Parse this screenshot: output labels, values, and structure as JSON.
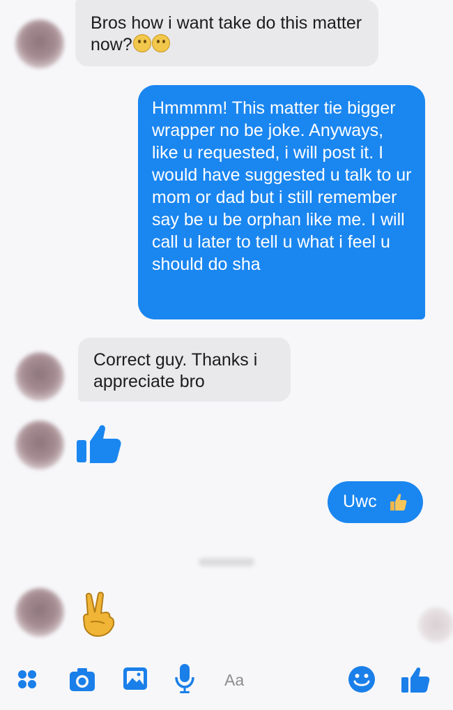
{
  "conversation": {
    "messages": [
      {
        "from": "them",
        "text": "Bros how i want take do this matter now?"
      },
      {
        "from": "me",
        "text": "Hmmmm! This matter tie bigger wrapper no be joke. Anyways, like u requested, i will post it. I would have suggested u talk to ur mom or dad but i still remember say be u be orphan like me. I will call u later to tell u what i feel u should do sha"
      },
      {
        "from": "them",
        "text": "Correct guy. Thanks i appreciate bro"
      },
      {
        "from": "them",
        "type": "sticker",
        "icon": "thumbs-up-icon"
      },
      {
        "from": "me",
        "text": "Uwc"
      },
      {
        "from": "them",
        "type": "emoji",
        "icon": "victory-hand-icon"
      }
    ]
  },
  "composer": {
    "placeholder": "Aa",
    "icons": [
      "menu-dots-icon",
      "camera-icon",
      "gallery-icon",
      "microphone-icon",
      "smiley-icon",
      "thumbs-up-icon"
    ]
  },
  "colors": {
    "outgoing_bubble": "#1a86f0",
    "incoming_bubble": "#e9e9ec",
    "accent": "#1a7fe9"
  }
}
